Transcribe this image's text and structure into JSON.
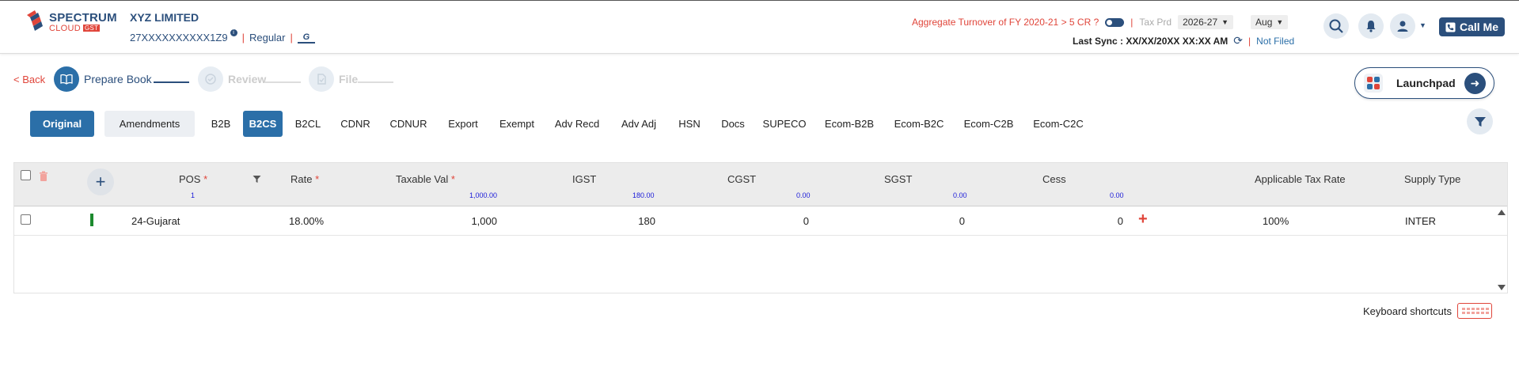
{
  "header": {
    "logo_line1": "SPECTRUM",
    "logo_line2": "CLOUD",
    "logo_badge": "GST",
    "company": "XYZ LIMITED",
    "gstin": "27XXXXXXXXXX1Z9",
    "sep1": "|",
    "taxpayer_type": "Regular",
    "sep2": "|",
    "gstn_icon": "GSTN",
    "aggregate_turnover": "Aggregate Turnover of FY 2020-21 > 5 CR ?",
    "bar": "|",
    "tax_period_label": "Tax Prd",
    "year": "2026-27",
    "month": "Aug",
    "last_sync": "Last Sync : XX/XX/20XX XX:XX AM",
    "bar2": "|",
    "filing_status": "Not Filed",
    "call_me": "Call Me"
  },
  "stepper": {
    "back": "< Back",
    "steps": [
      {
        "label": "Prepare Book",
        "state": "active"
      },
      {
        "label": "Review",
        "state": "inactive"
      },
      {
        "label": "File",
        "state": "inactive"
      }
    ]
  },
  "launchpad": {
    "label": "Launchpad"
  },
  "tabs": {
    "original": "Original",
    "amendments": "Amendments",
    "items": [
      "B2B",
      "B2CS",
      "B2CL",
      "CDNR",
      "CDNUR",
      "Export",
      "Exempt",
      "Adv Recd",
      "Adv Adj",
      "HSN",
      "Docs",
      "SUPECO",
      "Ecom-B2B",
      "Ecom-B2C",
      "Ecom-C2B",
      "Ecom-C2C"
    ],
    "active": "B2CS"
  },
  "table": {
    "headers": {
      "pos": "POS",
      "rate": "Rate",
      "taxable": "Taxable Val",
      "igst": "IGST",
      "cgst": "CGST",
      "sgst": "SGST",
      "cess": "Cess",
      "applicable_rate": "Applicable Tax Rate",
      "supply_type": "Supply Type",
      "required_mark": "*"
    },
    "totals": {
      "pos": "1",
      "taxable": "1,000.00",
      "igst": "180.00",
      "cgst": "0.00",
      "sgst": "0.00",
      "cess": "0.00"
    },
    "rows": [
      {
        "pos": "24-Gujarat",
        "rate": "18.00%",
        "taxable": "1,000",
        "igst": "180",
        "cgst": "0",
        "sgst": "0",
        "cess": "0",
        "applicable_rate": "100%",
        "supply_type": "INTER"
      }
    ]
  },
  "footer": {
    "keyboard_shortcuts": "Keyboard shortcuts"
  },
  "colors": {
    "primary": "#2b4f7c",
    "accent_blue": "#2b6fa8",
    "red": "#e0453a",
    "green": "#1c8a2e"
  }
}
